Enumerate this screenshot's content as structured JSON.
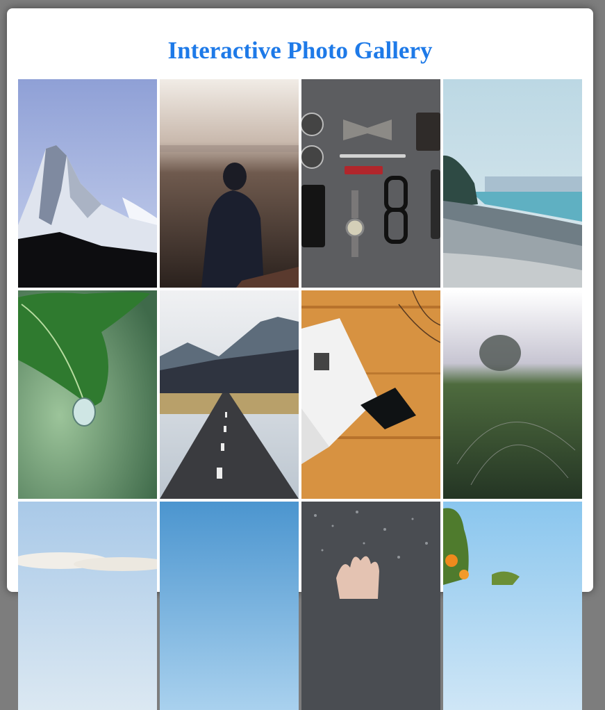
{
  "gallery": {
    "title": "Interactive Photo Gallery",
    "accent_color": "#1e7ae8",
    "photos": [
      {
        "subject": "snowy-mountain-peak"
      },
      {
        "subject": "person-overlooking-city"
      },
      {
        "subject": "flatlay-accessories"
      },
      {
        "subject": "rocky-shoreline"
      },
      {
        "subject": "leaf-water-drop"
      },
      {
        "subject": "mountain-road"
      },
      {
        "subject": "magazine-on-wood-table"
      },
      {
        "subject": "misty-field-spiderweb"
      },
      {
        "subject": "clouds-sky"
      },
      {
        "subject": "blue-sky"
      },
      {
        "subject": "hand-on-wet-glass"
      },
      {
        "subject": "orange-tree"
      }
    ]
  }
}
